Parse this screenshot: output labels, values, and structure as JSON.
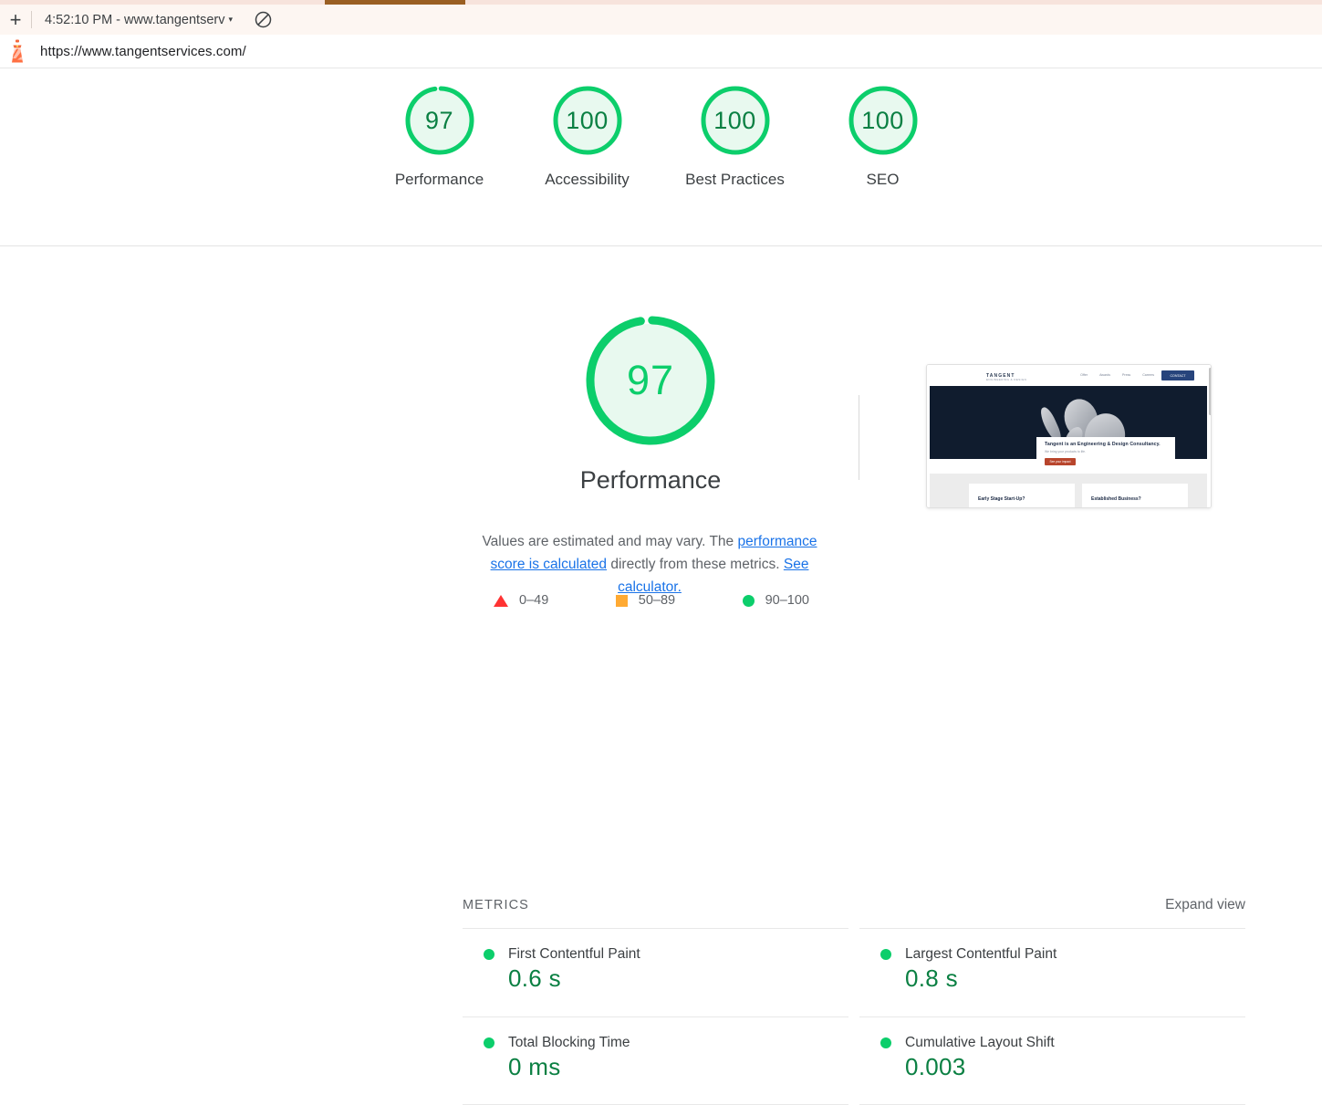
{
  "browser": {
    "new_tab_label": "+",
    "session_label": "4:52:10 PM - www.tangentserv",
    "caret": "▾",
    "block_icon": "no-entry-icon",
    "url": "https://www.tangentservices.com/",
    "lighthouse_icon": "lighthouse-icon"
  },
  "score_header": {
    "gauges": [
      {
        "score": "97",
        "label": "Performance",
        "pct": 97
      },
      {
        "score": "100",
        "label": "Accessibility",
        "pct": 100
      },
      {
        "score": "100",
        "label": "Best Practices",
        "pct": 100
      },
      {
        "score": "100",
        "label": "SEO",
        "pct": 100
      }
    ]
  },
  "category": {
    "score": "97",
    "title": "Performance",
    "description_pre": "Values are estimated and may vary. The ",
    "link1": "performance score is calculated",
    "description_mid": " directly from these metrics. ",
    "link2": "See calculator.",
    "legend": [
      {
        "icon": "triangle-fail-icon",
        "range": "0–49",
        "color": "#f33"
      },
      {
        "icon": "square-average-icon",
        "range": "50–89",
        "color": "#fa3"
      },
      {
        "icon": "circle-pass-icon",
        "range": "90–100",
        "color": "#0cce6b"
      }
    ]
  },
  "thumbnail": {
    "logo": "TANGENT",
    "logo_sub": "ENGINEERING & DESIGN",
    "nav": [
      "Offer",
      "Awards",
      "Press",
      "Careers"
    ],
    "cta": "CONTACT",
    "hero_title": "Tangent is an Engineering & Design Consultancy.",
    "hero_sub": "We bring your products to life.",
    "hero_button": "See your impact",
    "cards": [
      "Early Stage Start-Up?",
      "Established Business?"
    ]
  },
  "metrics": {
    "title": "METRICS",
    "expand_view": "Expand view",
    "items": [
      {
        "name": "First Contentful Paint",
        "value": "0.6 s",
        "status": "pass"
      },
      {
        "name": "Largest Contentful Paint",
        "value": "0.8 s",
        "status": "pass"
      },
      {
        "name": "Total Blocking Time",
        "value": "0 ms",
        "status": "pass"
      },
      {
        "name": "Cumulative Layout Shift",
        "value": "0.003",
        "status": "pass"
      }
    ]
  },
  "colors": {
    "pass_green": "#0cce6b",
    "pass_text_green": "#0b8043",
    "gauge_fill": "#e8f9ef",
    "average_orange": "#fa3",
    "fail_red": "#f33",
    "link_blue": "#1a73e8",
    "progress_brown": "#9a5f23"
  }
}
